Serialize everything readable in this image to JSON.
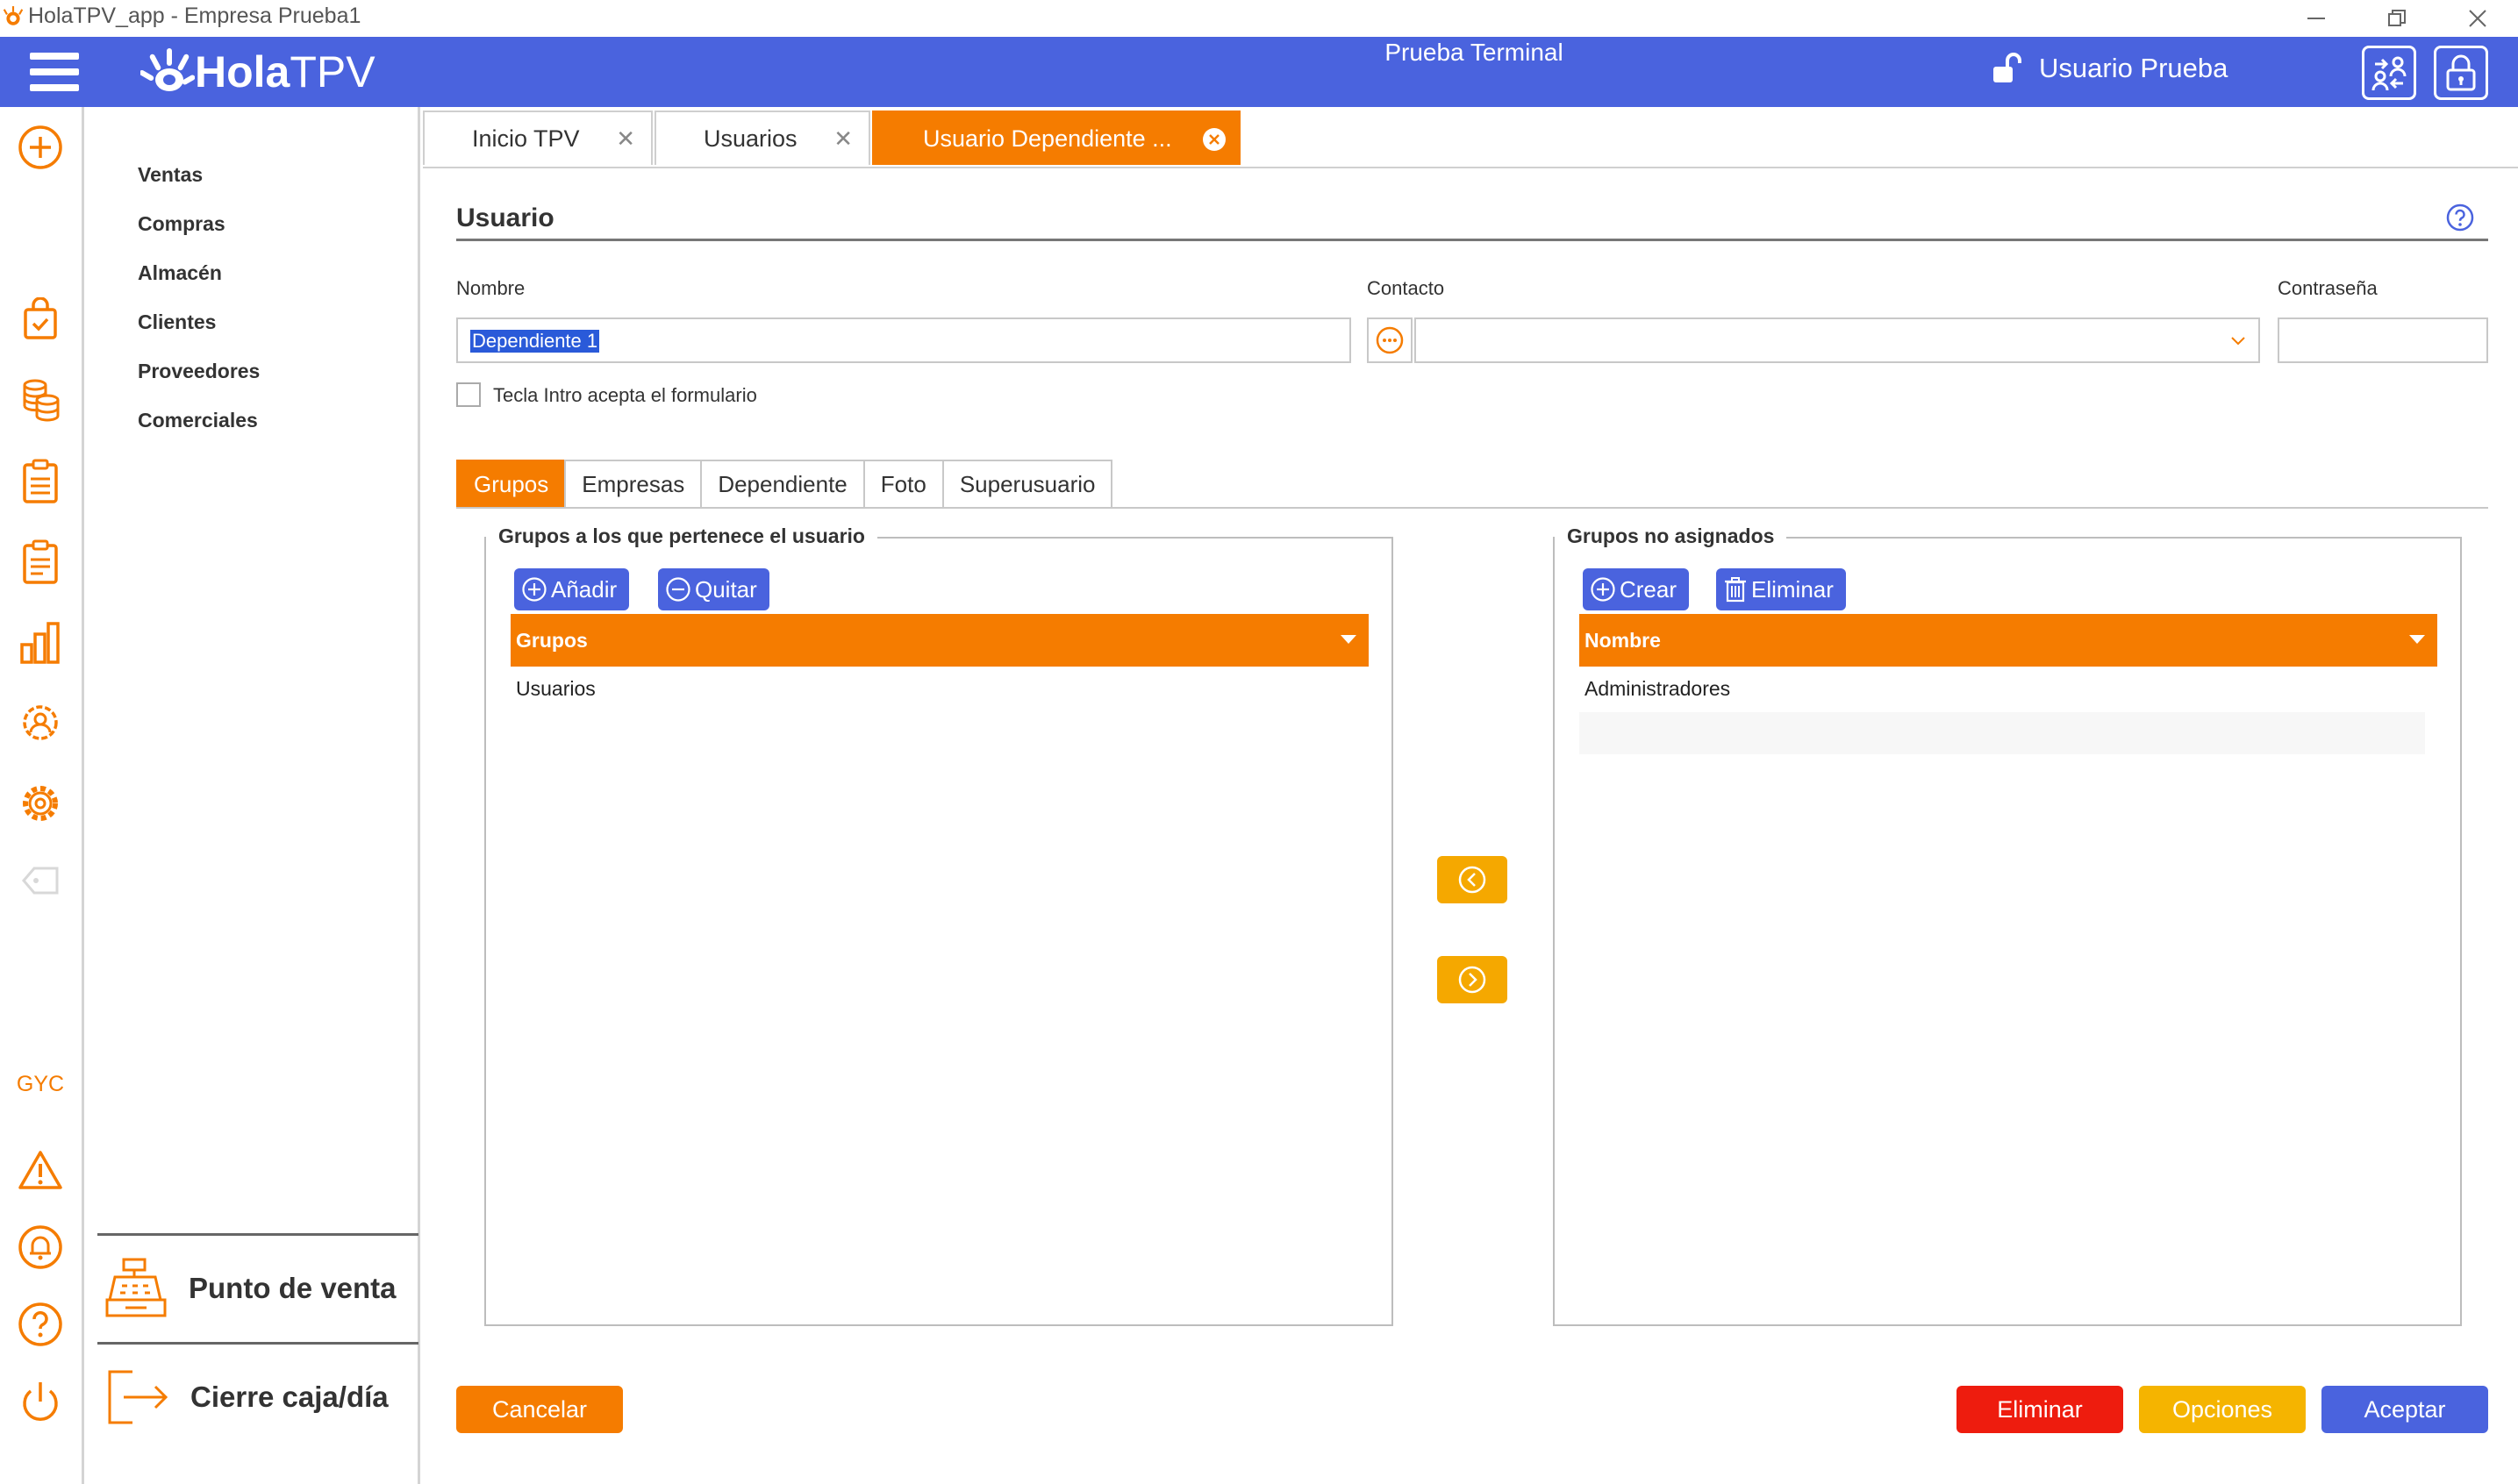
{
  "window": {
    "title": "HolaTPV_app - Empresa Prueba1"
  },
  "header": {
    "brand_a": "Hola",
    "brand_b": "TPV",
    "terminal": "Prueba Terminal",
    "user": "Usuario Prueba"
  },
  "sidebar": {
    "gyc": "GYC",
    "menu": [
      "Ventas",
      "Compras",
      "Almacén",
      "Clientes",
      "Proveedores",
      "Comerciales"
    ],
    "pos_label": "Punto de venta",
    "close_label": "Cierre caja/día"
  },
  "tabs": [
    {
      "label": "Inicio TPV"
    },
    {
      "label": "Usuarios"
    },
    {
      "label": "Usuario Dependiente ..."
    }
  ],
  "form": {
    "section_title": "Usuario",
    "nombre_label": "Nombre",
    "nombre_value": "Dependiente 1",
    "contacto_label": "Contacto",
    "contrasena_label": "Contraseña",
    "checkbox_label": "Tecla Intro acepta el formulario"
  },
  "subtabs": [
    "Grupos",
    "Empresas",
    "Dependiente",
    "Foto",
    "Superusuario"
  ],
  "groups_left": {
    "legend": "Grupos a los que pertenece el usuario",
    "add_label": "Añadir",
    "remove_label": "Quitar",
    "column": "Grupos",
    "rows": [
      "Usuarios"
    ]
  },
  "groups_right": {
    "legend": "Grupos no asignados",
    "create_label": "Crear",
    "delete_label": "Eliminar",
    "column": "Nombre",
    "rows": [
      "Administradores"
    ]
  },
  "footer": {
    "cancel": "Cancelar",
    "delete": "Eliminar",
    "options": "Opciones",
    "accept": "Aceptar"
  },
  "colors": {
    "brand_blue": "#4a63de",
    "accent_orange": "#f57c00",
    "arrow_yellow": "#f5a800",
    "danger_red": "#ee1c0e",
    "options_yellow": "#f5b400"
  }
}
